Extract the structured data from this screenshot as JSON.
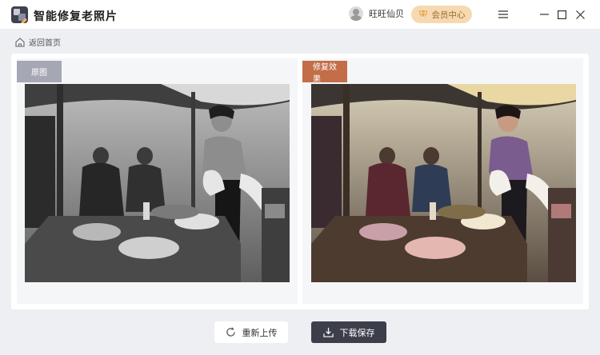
{
  "app": {
    "title": "智能修复老照片",
    "user_name": "旺旺仙贝",
    "vip_label": "会员中心"
  },
  "nav": {
    "back_label": "返回首页"
  },
  "compare": {
    "original_label": "原图",
    "result_label": "修复效果"
  },
  "actions": {
    "reupload_label": "重新上传",
    "download_label": "下载保存"
  },
  "colors": {
    "accent_dark": "#3c3e4a",
    "vip_bg": "#f6d9b0",
    "original_tag": "#a6a7b4",
    "result_tag": "#c36e48"
  },
  "icons": {
    "logo": "app-logo-icon",
    "avatar": "avatar-icon",
    "vip": "diamond-icon",
    "menu": "menu-icon",
    "minimize": "minimize-icon",
    "maximize": "maximize-icon",
    "close": "close-icon",
    "back": "home-icon",
    "reupload": "refresh-icon",
    "download": "download-icon"
  }
}
